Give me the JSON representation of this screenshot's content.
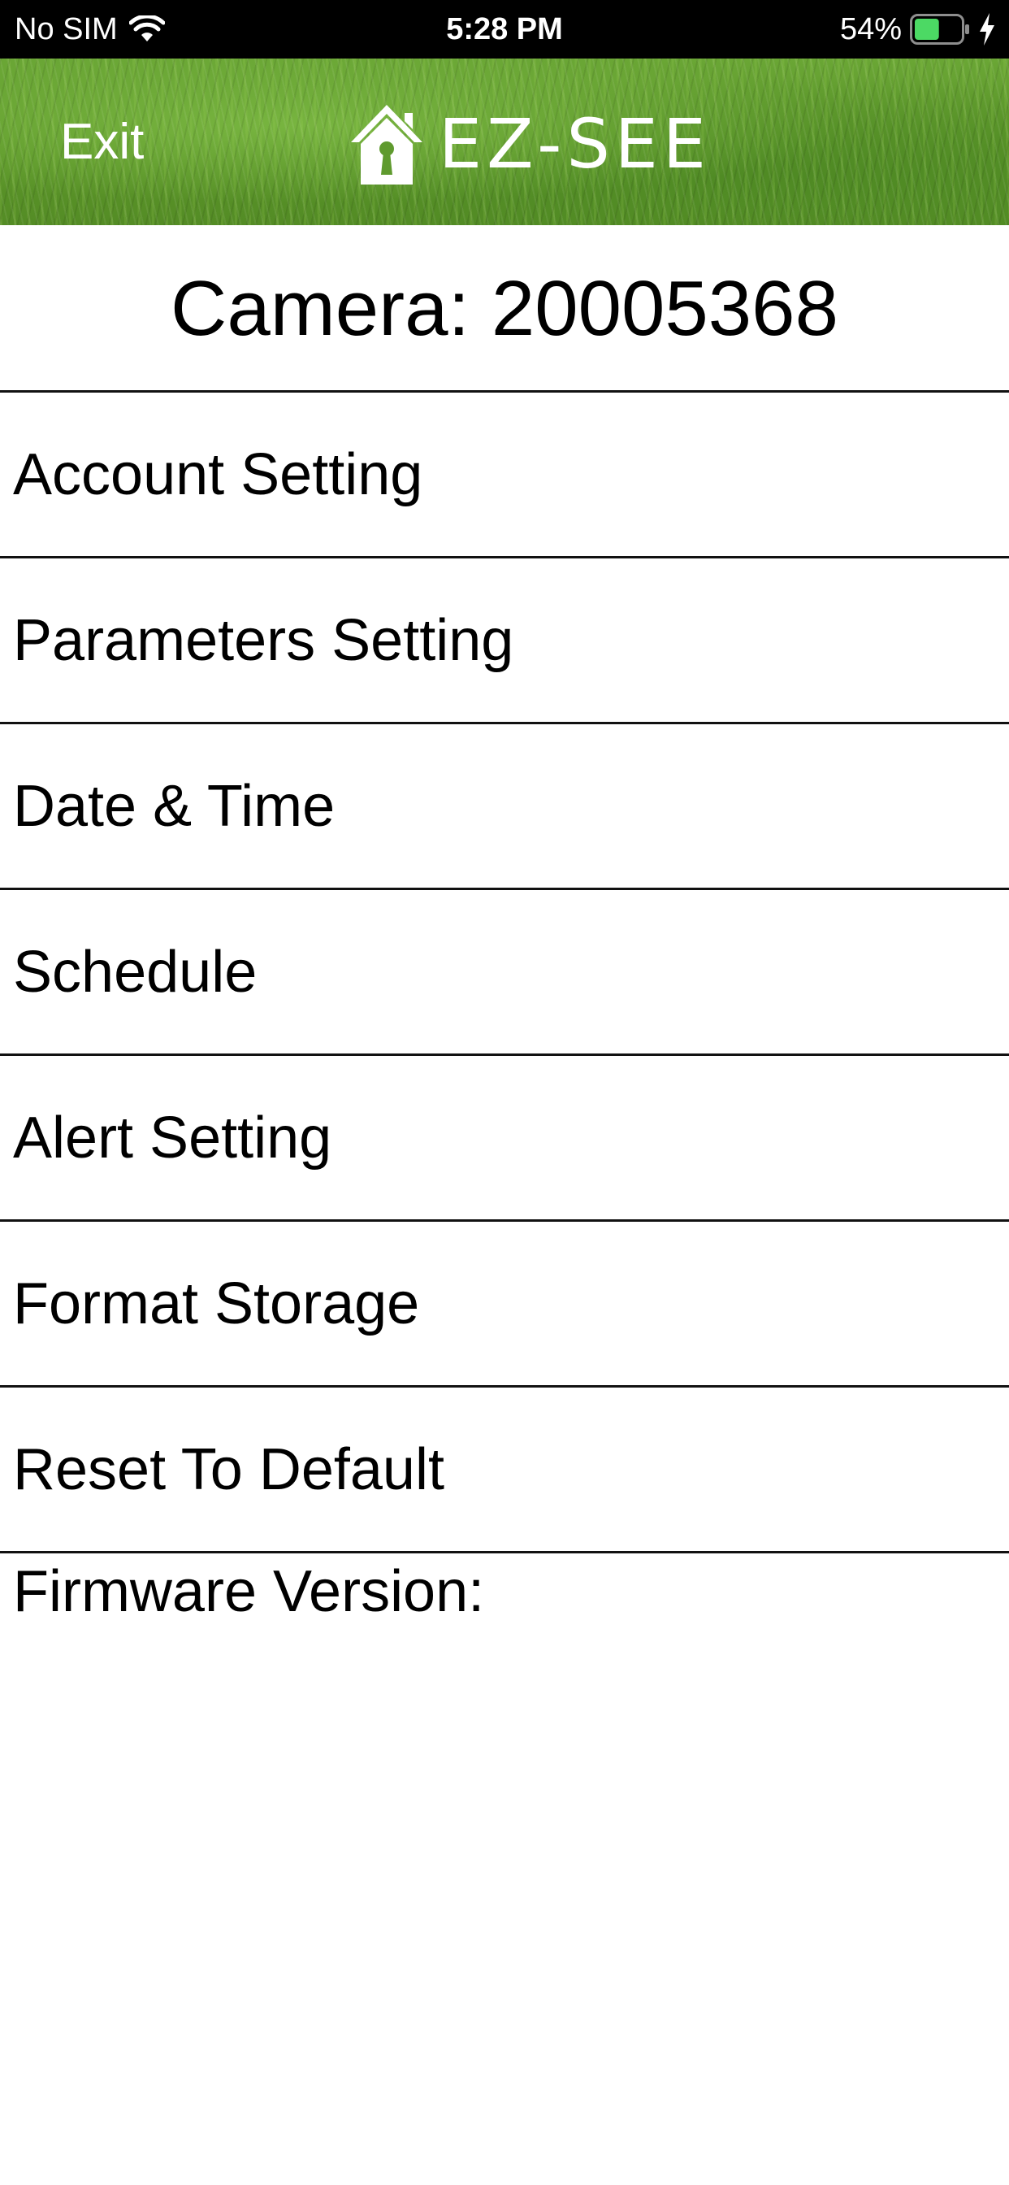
{
  "status_bar": {
    "carrier": "No SIM",
    "time": "5:28 PM",
    "battery_percent": "54%",
    "battery_level": 0.54,
    "icons": [
      "wifi-icon",
      "battery-icon",
      "charging-bolt-icon"
    ]
  },
  "header": {
    "exit_label": "Exit",
    "logo_text": "EZ-SEE",
    "logo_icon": "house-keyhole-icon"
  },
  "camera": {
    "title": "Camera: 20005368"
  },
  "menu": {
    "items": [
      {
        "label": "Account Setting"
      },
      {
        "label": "Parameters Setting"
      },
      {
        "label": "Date & Time"
      },
      {
        "label": "Schedule"
      },
      {
        "label": "Alert Setting"
      },
      {
        "label": "Format Storage"
      },
      {
        "label": "Reset To Default"
      }
    ]
  },
  "firmware": {
    "label": "Firmware Version:"
  },
  "colors": {
    "status_bar_bg": "#000000",
    "header_green": "#5f9a2e",
    "battery_fill": "#4cd964",
    "divider": "#111111"
  }
}
